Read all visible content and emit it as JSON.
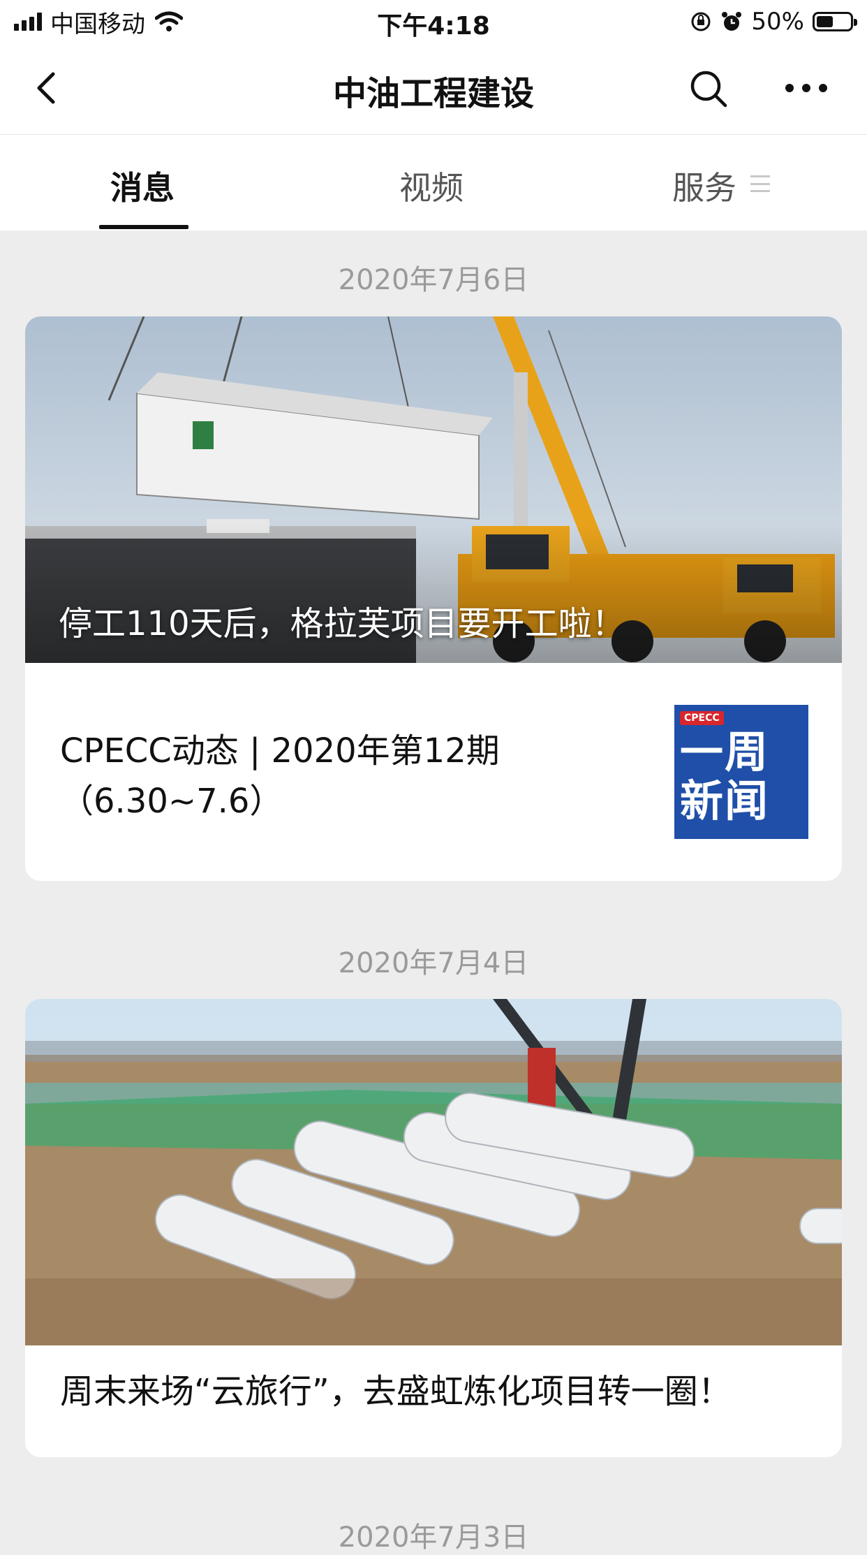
{
  "status_bar": {
    "carrier": "中国移动",
    "time": "下午4:18",
    "battery_percent": "50%",
    "battery_level": 0.5
  },
  "nav": {
    "title": "中油工程建设",
    "back_icon": "chevron-left-icon",
    "search_icon": "search-icon",
    "more_icon": "more-dots-icon"
  },
  "tabs": [
    {
      "label": "消息",
      "active": true
    },
    {
      "label": "视频",
      "active": false
    },
    {
      "label": "服务",
      "active": false
    }
  ],
  "feed": [
    {
      "date": "2020年7月6日",
      "main_title": "停工110天后，格拉芙项目要开工啦！",
      "sub_items": [
        {
          "title": "CPECC动态 | 2020年第12期（6.30~7.6）",
          "thumb_brand": "CPECC",
          "thumb_text_line1": "一周",
          "thumb_text_line2": "新闻"
        }
      ]
    },
    {
      "date": "2020年7月4日",
      "main_title": "周末来场“云旅行”，去盛虹炼化项目转一圈！"
    },
    {
      "date": "2020年7月3日"
    }
  ],
  "colors": {
    "background": "#ededed",
    "thumb_blue": "#1f4fa8",
    "thumb_red": "#d8262c"
  }
}
